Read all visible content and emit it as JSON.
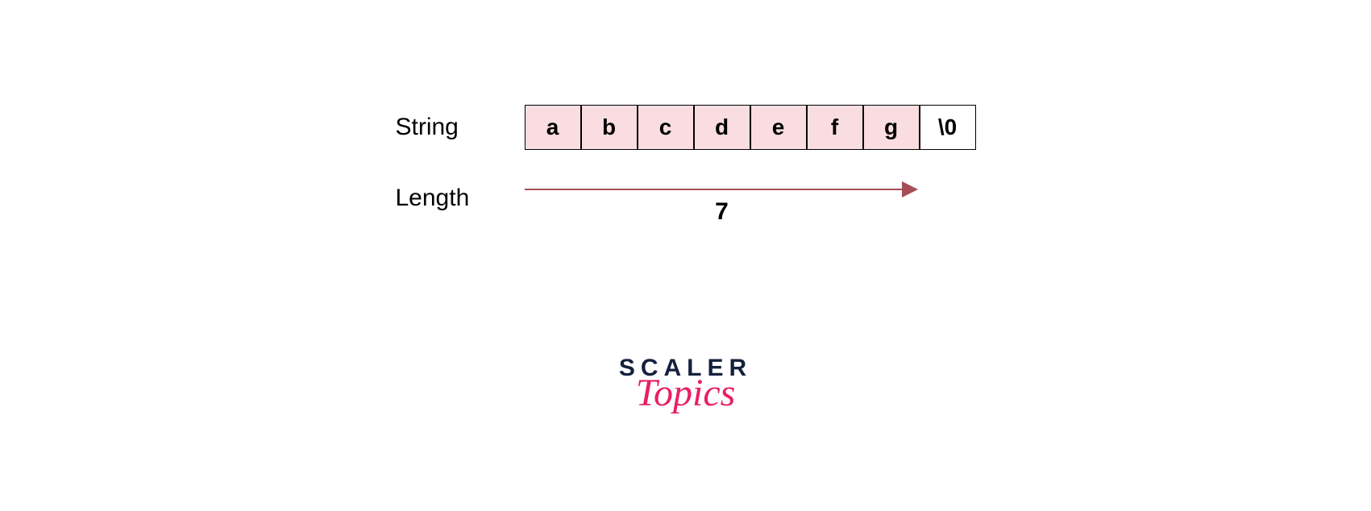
{
  "labels": {
    "string": "String",
    "length": "Length"
  },
  "cells": [
    {
      "value": "a",
      "color": "pink"
    },
    {
      "value": "b",
      "color": "pink"
    },
    {
      "value": "c",
      "color": "pink"
    },
    {
      "value": "d",
      "color": "pink"
    },
    {
      "value": "e",
      "color": "pink"
    },
    {
      "value": "f",
      "color": "pink"
    },
    {
      "value": "g",
      "color": "pink"
    },
    {
      "value": "\\0",
      "color": "white"
    }
  ],
  "length_value": "7",
  "logo": {
    "top": "SCALER",
    "bottom": "Topics"
  }
}
